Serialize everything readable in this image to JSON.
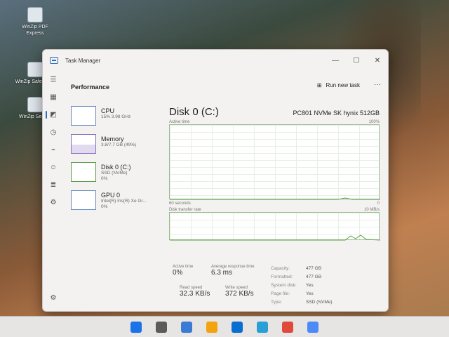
{
  "desktop": {
    "icons": [
      {
        "label": "WinZip PDF Express"
      },
      {
        "label": "WinZip SafeShare"
      },
      {
        "label": "WinZip Secure"
      }
    ]
  },
  "window": {
    "title": "Task Manager",
    "controls": {
      "minimize": "—",
      "maximize": "☐",
      "close": "✕"
    }
  },
  "header": {
    "title": "Performance",
    "run_new_task": "Run new task",
    "more": "···"
  },
  "nav": {
    "icons": [
      "menu-icon",
      "processes-icon",
      "performance-icon",
      "app-history-icon",
      "startup-icon",
      "users-icon",
      "details-icon",
      "services-icon",
      "settings-icon"
    ]
  },
  "perf_items": [
    {
      "name": "CPU",
      "sub": "15% 3.98 GHz"
    },
    {
      "name": "Memory",
      "sub": "3.8/7.7 GB (49%)"
    },
    {
      "name": "Disk 0 (C:)",
      "sub": "SSD (NVMe)",
      "sub2": "0%"
    },
    {
      "name": "GPU 0",
      "sub": "Intel(R) Iris(R) Xe Gr...",
      "sub2": "0%"
    }
  ],
  "detail": {
    "title": "Disk 0 (C:)",
    "model": "PC801 NVMe SK hynix 512GB",
    "active_time_label": "Active time",
    "active_time_max": "100%",
    "seconds_label": "60 seconds",
    "zero": "0",
    "transfer_label": "Disk transfer rate",
    "transfer_max": "10 MB/s",
    "transfer_mid": "7 MB/s"
  },
  "stats": {
    "active_time": {
      "label": "Active time",
      "value": "0%"
    },
    "response": {
      "label": "Average response time",
      "value": "6.3 ms"
    },
    "read": {
      "label": "Read speed",
      "value": "32.3 KB/s"
    },
    "write": {
      "label": "Write speed",
      "value": "372 KB/s"
    },
    "properties": [
      {
        "k": "Capacity:",
        "v": "477 GB"
      },
      {
        "k": "Formatted:",
        "v": "477 GB"
      },
      {
        "k": "System disk:",
        "v": "Yes"
      },
      {
        "k": "Page file:",
        "v": "Yes"
      },
      {
        "k": "Type:",
        "v": "SSD (NVMe)"
      }
    ]
  },
  "taskbar": {
    "colors": [
      "#1a73e8",
      "#5b5b5b",
      "#3a7bd5",
      "#f2a30f",
      "#0a6ed1",
      "#2a9fd6",
      "#e04a3a",
      "#4c8bf5"
    ]
  }
}
